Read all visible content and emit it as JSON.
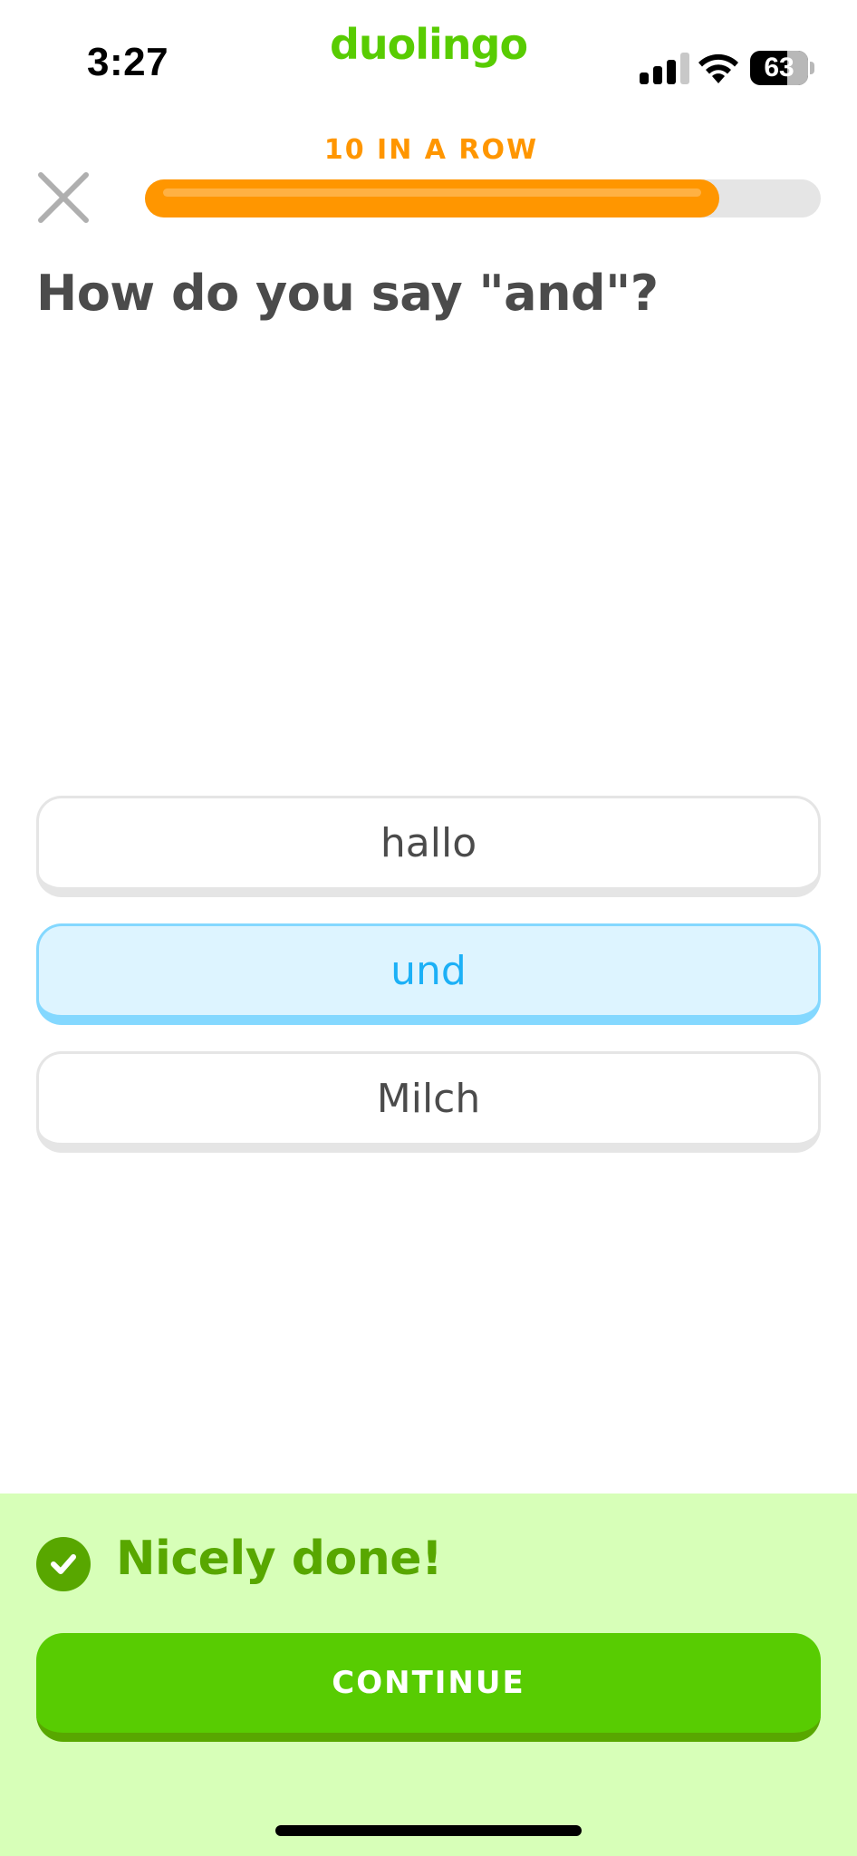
{
  "status_bar": {
    "time": "3:27",
    "battery_level": "63",
    "signal_icon": "cellular-signal-icon",
    "wifi_icon": "wifi-icon"
  },
  "app": {
    "brand": "duolingo",
    "brand_color": "#58cc02"
  },
  "header": {
    "streak_label": "10 IN A ROW",
    "progress_fraction": 0.85,
    "progress_color": "#ff9600",
    "close_icon": "close-icon"
  },
  "question": {
    "text": "How do you say \"and\"?"
  },
  "options": [
    {
      "label": "hallo",
      "selected": false
    },
    {
      "label": "und",
      "selected": true
    },
    {
      "label": "Milch",
      "selected": false
    }
  ],
  "feedback": {
    "title": "Nicely done!",
    "icon": "checkmark-icon",
    "continue_label": "CONTINUE",
    "success_color": "#58a700"
  }
}
